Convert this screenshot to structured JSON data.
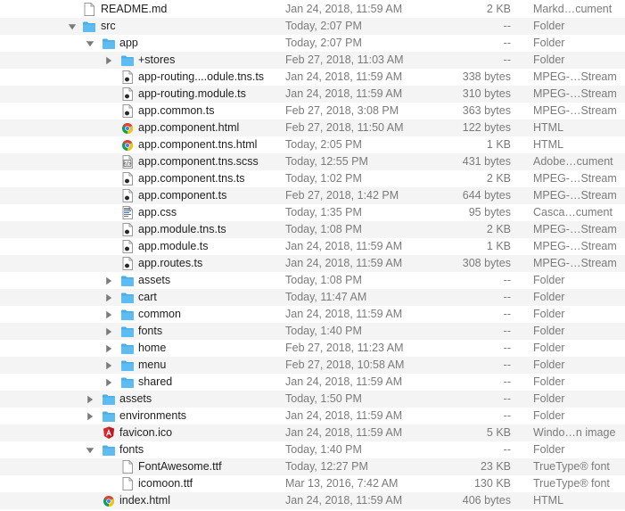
{
  "colors": {
    "folder": "#5dbcf2",
    "folder_tab": "#4aaee6",
    "text_primary": "#1f1f1f",
    "text_secondary": "#7b7b7b",
    "stripe": "#f4f4f5",
    "angular_red": "#d6262f",
    "chrome_red": "#db4437",
    "chrome_yellow": "#f4c20d",
    "chrome_green": "#0f9d58",
    "chrome_blue": "#4285f4"
  },
  "rows": [
    {
      "id": "readme-md",
      "name": "README.md",
      "date": "Jan 24, 2018, 11:59 AM",
      "size": "2 KB",
      "kind": "Markd…cument",
      "depth": 1,
      "icon": "document-icon",
      "disclosure": "none"
    },
    {
      "id": "src",
      "name": "src",
      "date": "Today, 2:07 PM",
      "size": "--",
      "kind": "Folder",
      "depth": 1,
      "icon": "folder-icon",
      "disclosure": "expanded"
    },
    {
      "id": "app",
      "name": "app",
      "date": "Today, 2:07 PM",
      "size": "--",
      "kind": "Folder",
      "depth": 2,
      "icon": "folder-icon",
      "disclosure": "expanded"
    },
    {
      "id": "stores",
      "name": "+stores",
      "date": "Feb 27, 2018, 11:03 AM",
      "size": "--",
      "kind": "Folder",
      "depth": 3,
      "icon": "folder-icon",
      "disclosure": "collapsed"
    },
    {
      "id": "app-routing-odule-tns-ts",
      "name": "app-routing....odule.tns.ts",
      "date": "Jan 24, 2018, 11:59 AM",
      "size": "338 bytes",
      "kind": "MPEG-…Stream",
      "depth": 3,
      "icon": "ts-file-icon",
      "disclosure": "none"
    },
    {
      "id": "app-routing-module-ts",
      "name": "app-routing.module.ts",
      "date": "Jan 24, 2018, 11:59 AM",
      "size": "310 bytes",
      "kind": "MPEG-…Stream",
      "depth": 3,
      "icon": "ts-file-icon",
      "disclosure": "none"
    },
    {
      "id": "app-common-ts",
      "name": "app.common.ts",
      "date": "Feb 27, 2018, 3:08 PM",
      "size": "363 bytes",
      "kind": "MPEG-…Stream",
      "depth": 3,
      "icon": "ts-file-icon",
      "disclosure": "none"
    },
    {
      "id": "app-component-html",
      "name": "app.component.html",
      "date": "Feb 27, 2018, 11:50 AM",
      "size": "122 bytes",
      "kind": "HTML",
      "depth": 3,
      "icon": "chrome-html-icon",
      "disclosure": "none"
    },
    {
      "id": "app-component-tns-html",
      "name": "app.component.tns.html",
      "date": "Today, 2:05 PM",
      "size": "1 KB",
      "kind": "HTML",
      "depth": 3,
      "icon": "chrome-html-icon",
      "disclosure": "none"
    },
    {
      "id": "app-component-tns-scss",
      "name": "app.component.tns.scss",
      "date": "Today, 12:55 PM",
      "size": "431 bytes",
      "kind": "Adobe…cument",
      "depth": 3,
      "icon": "code-file-icon",
      "disclosure": "none"
    },
    {
      "id": "app-component-tns-ts",
      "name": "app.component.tns.ts",
      "date": "Today, 1:02 PM",
      "size": "2 KB",
      "kind": "MPEG-…Stream",
      "depth": 3,
      "icon": "ts-file-icon",
      "disclosure": "none"
    },
    {
      "id": "app-component-ts",
      "name": "app.component.ts",
      "date": "Feb 27, 2018, 1:42 PM",
      "size": "644 bytes",
      "kind": "MPEG-…Stream",
      "depth": 3,
      "icon": "ts-file-icon",
      "disclosure": "none"
    },
    {
      "id": "app-css",
      "name": "app.css",
      "date": "Today, 1:35 PM",
      "size": "95 bytes",
      "kind": "Casca…cument",
      "depth": 3,
      "icon": "css-file-icon",
      "disclosure": "none"
    },
    {
      "id": "app-module-tns-ts",
      "name": "app.module.tns.ts",
      "date": "Today, 1:08 PM",
      "size": "2 KB",
      "kind": "MPEG-…Stream",
      "depth": 3,
      "icon": "ts-file-icon",
      "disclosure": "none"
    },
    {
      "id": "app-module-ts",
      "name": "app.module.ts",
      "date": "Jan 24, 2018, 11:59 AM",
      "size": "1 KB",
      "kind": "MPEG-…Stream",
      "depth": 3,
      "icon": "ts-file-icon",
      "disclosure": "none"
    },
    {
      "id": "app-routes-ts",
      "name": "app.routes.ts",
      "date": "Jan 24, 2018, 11:59 AM",
      "size": "308 bytes",
      "kind": "MPEG-…Stream",
      "depth": 3,
      "icon": "ts-file-icon",
      "disclosure": "none"
    },
    {
      "id": "app-assets",
      "name": "assets",
      "date": "Today, 1:08 PM",
      "size": "--",
      "kind": "Folder",
      "depth": 3,
      "icon": "folder-icon",
      "disclosure": "collapsed"
    },
    {
      "id": "cart",
      "name": "cart",
      "date": "Today, 11:47 AM",
      "size": "--",
      "kind": "Folder",
      "depth": 3,
      "icon": "folder-icon",
      "disclosure": "collapsed"
    },
    {
      "id": "common",
      "name": "common",
      "date": "Jan 24, 2018, 11:59 AM",
      "size": "--",
      "kind": "Folder",
      "depth": 3,
      "icon": "folder-icon",
      "disclosure": "collapsed"
    },
    {
      "id": "app-fonts",
      "name": "fonts",
      "date": "Today, 1:40 PM",
      "size": "--",
      "kind": "Folder",
      "depth": 3,
      "icon": "folder-icon",
      "disclosure": "collapsed"
    },
    {
      "id": "home",
      "name": "home",
      "date": "Feb 27, 2018, 11:23 AM",
      "size": "--",
      "kind": "Folder",
      "depth": 3,
      "icon": "folder-icon",
      "disclosure": "collapsed"
    },
    {
      "id": "menu",
      "name": "menu",
      "date": "Feb 27, 2018, 10:58 AM",
      "size": "--",
      "kind": "Folder",
      "depth": 3,
      "icon": "folder-icon",
      "disclosure": "collapsed"
    },
    {
      "id": "shared",
      "name": "shared",
      "date": "Jan 24, 2018, 11:59 AM",
      "size": "--",
      "kind": "Folder",
      "depth": 3,
      "icon": "folder-icon",
      "disclosure": "collapsed"
    },
    {
      "id": "assets",
      "name": "assets",
      "date": "Today, 1:50 PM",
      "size": "--",
      "kind": "Folder",
      "depth": 2,
      "icon": "folder-icon",
      "disclosure": "collapsed"
    },
    {
      "id": "environments",
      "name": "environments",
      "date": "Jan 24, 2018, 11:59 AM",
      "size": "--",
      "kind": "Folder",
      "depth": 2,
      "icon": "folder-icon",
      "disclosure": "collapsed"
    },
    {
      "id": "favicon-ico",
      "name": "favicon.ico",
      "date": "Jan 24, 2018, 11:59 AM",
      "size": "5 KB",
      "kind": "Windo…n image",
      "depth": 2,
      "icon": "angular-icon",
      "disclosure": "none"
    },
    {
      "id": "fonts",
      "name": "fonts",
      "date": "Today, 1:40 PM",
      "size": "--",
      "kind": "Folder",
      "depth": 2,
      "icon": "folder-icon",
      "disclosure": "expanded"
    },
    {
      "id": "fontawesome-ttf",
      "name": "FontAwesome.ttf",
      "date": "Today, 12:27 PM",
      "size": "23 KB",
      "kind": "TrueType® font",
      "depth": 3,
      "icon": "document-icon",
      "disclosure": "none"
    },
    {
      "id": "icomoon-ttf",
      "name": "icomoon.ttf",
      "date": "Mar 13, 2016, 7:42 AM",
      "size": "130 KB",
      "kind": "TrueType® font",
      "depth": 3,
      "icon": "document-icon",
      "disclosure": "none"
    },
    {
      "id": "index-html",
      "name": "index.html",
      "date": "Jan 24, 2018, 11:59 AM",
      "size": "406 bytes",
      "kind": "HTML",
      "depth": 2,
      "icon": "chrome-html-icon",
      "disclosure": "none"
    }
  ]
}
